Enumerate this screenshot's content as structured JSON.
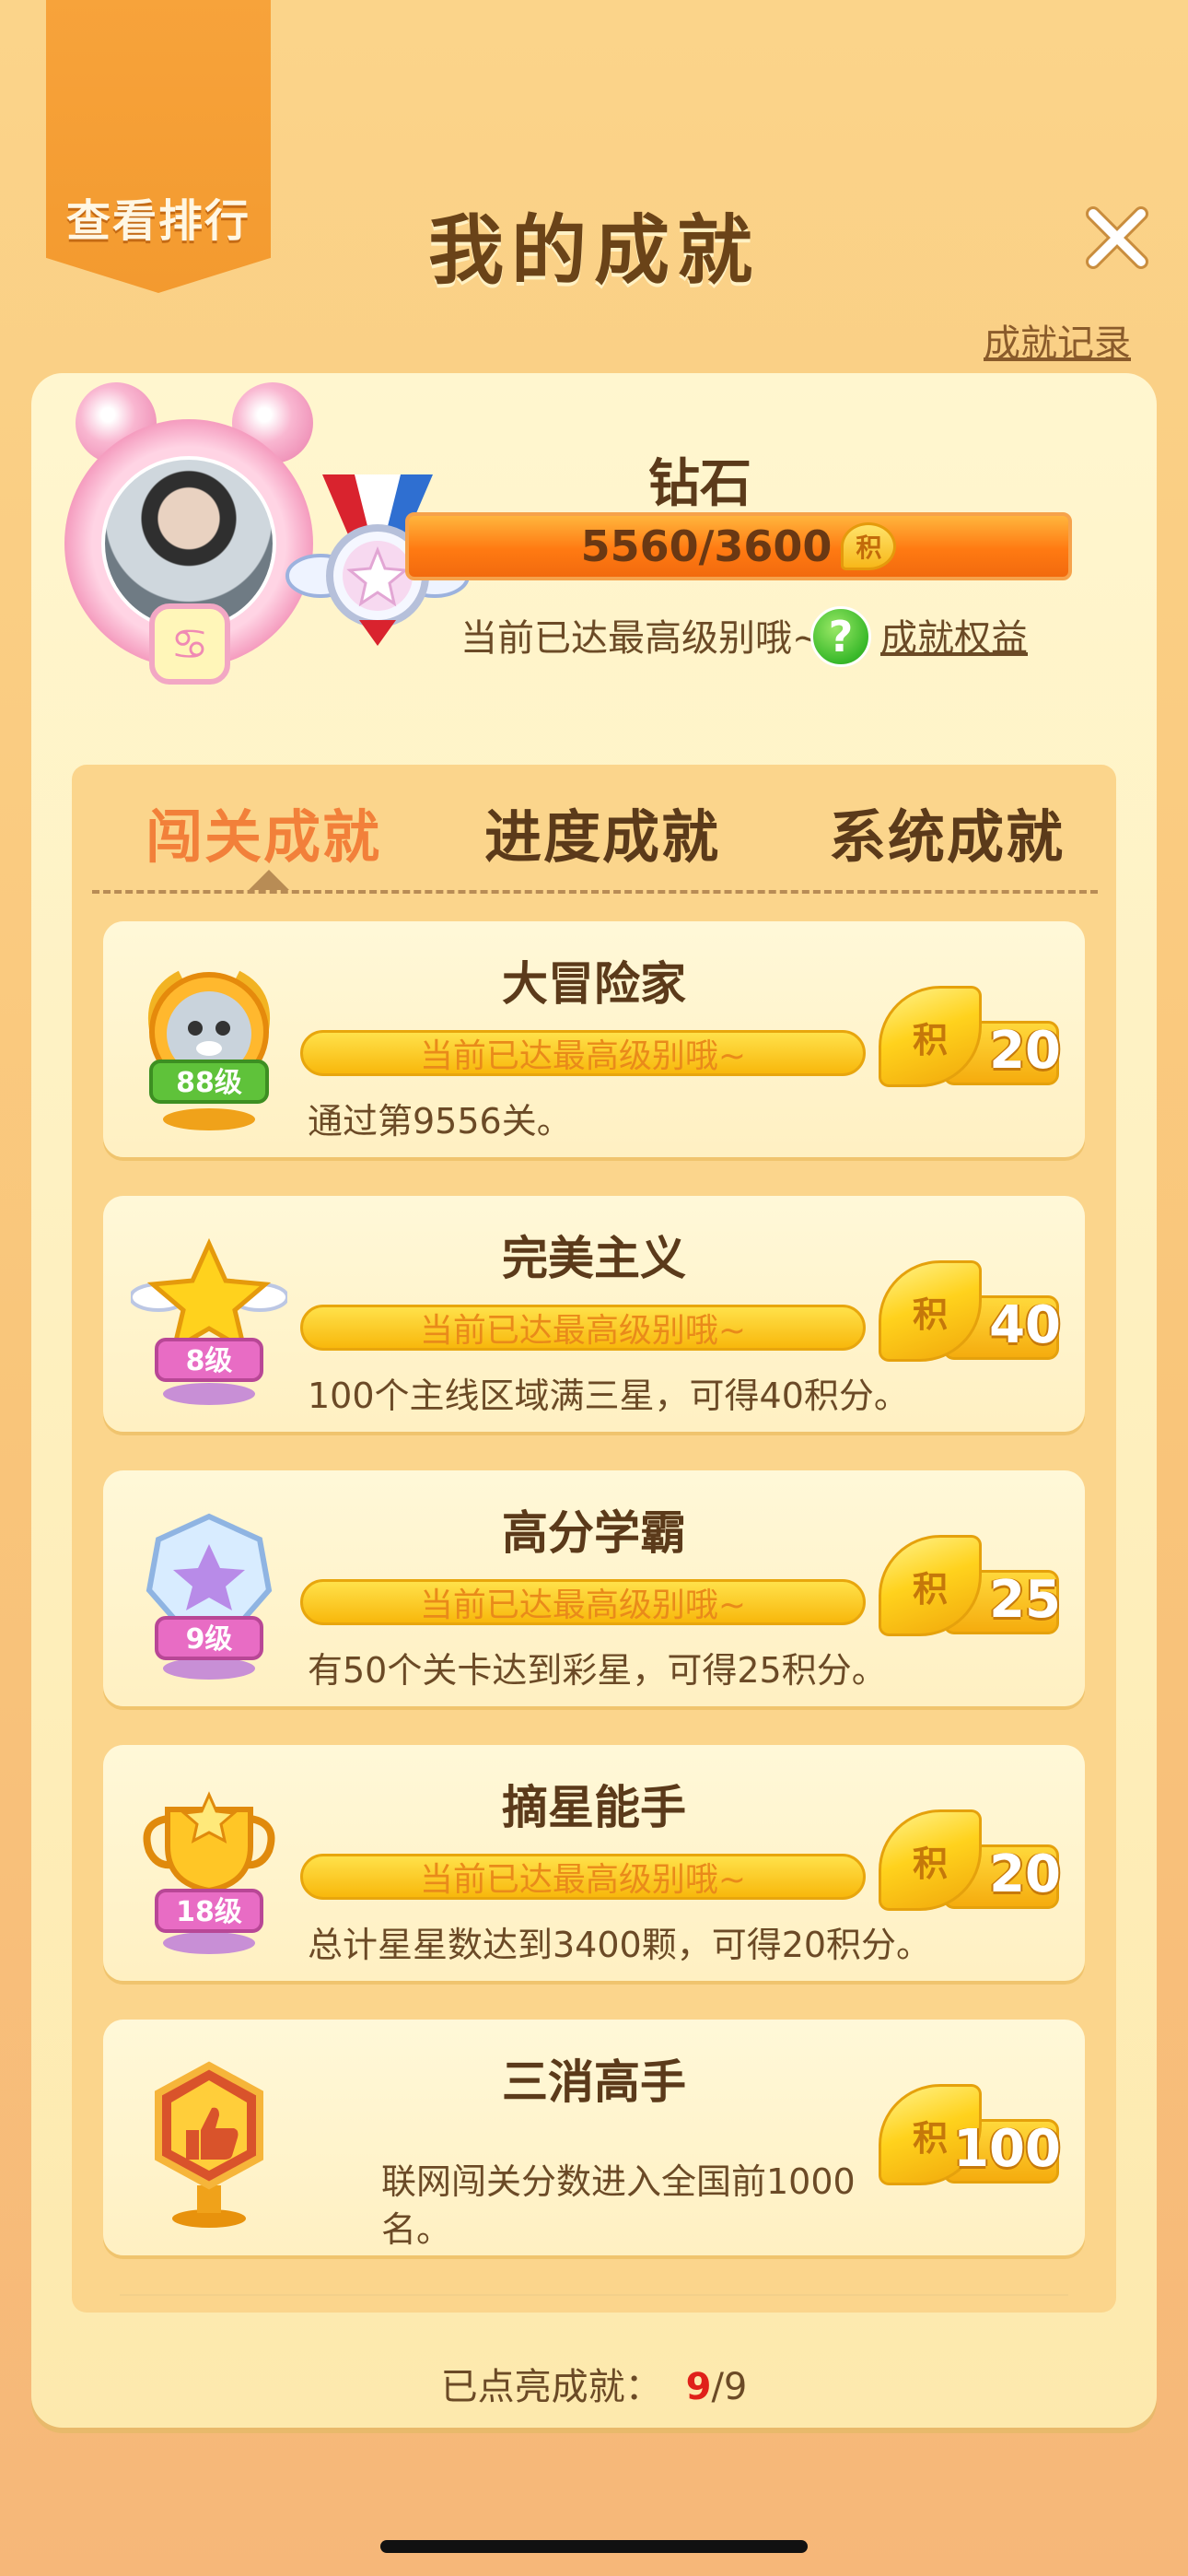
{
  "header": {
    "rank_button_label": "查看排行",
    "title": "我的成就",
    "record_link": "成就记录"
  },
  "profile": {
    "level_name": "钻石",
    "points_current": "5560",
    "points_max": "3600",
    "points_text": "5560/3600",
    "coin_glyph": "积",
    "status_note": "当前已达最高级别哦~",
    "help_glyph": "?",
    "benefit_link": "成就权益",
    "zodiac_glyph": "♋"
  },
  "tabs": [
    {
      "label": "闯关成就",
      "active": true
    },
    {
      "label": "进度成就",
      "active": false
    },
    {
      "label": "系统成就",
      "active": false
    }
  ],
  "achievements": [
    {
      "title": "大冒险家",
      "badge_level": "88级",
      "bar_text": "当前已达最高级别哦~",
      "description": "通过第9556关。",
      "reward_glyph": "积",
      "reward_points": "20"
    },
    {
      "title": "完美主义",
      "badge_level": "8级",
      "bar_text": "当前已达最高级别哦~",
      "description": "100个主线区域满三星，可得40积分。",
      "reward_glyph": "积",
      "reward_points": "40"
    },
    {
      "title": "高分学霸",
      "badge_level": "9级",
      "bar_text": "当前已达最高级别哦~",
      "description": "有50个关卡达到彩星，可得25积分。",
      "reward_glyph": "积",
      "reward_points": "25"
    },
    {
      "title": "摘星能手",
      "badge_level": "18级",
      "bar_text": "当前已达最高级别哦~",
      "description": "总计星星数达到3400颗，可得20积分。",
      "reward_glyph": "积",
      "reward_points": "20"
    },
    {
      "title": "三消高手",
      "description": "联网闯关分数进入全国前1000名。",
      "reward_glyph": "积",
      "reward_points": "100"
    }
  ],
  "footer": {
    "label": "已点亮成就：",
    "lit": "9",
    "total_text": "/9"
  },
  "colors": {
    "accent_orange": "#f2803a",
    "level_bar": "#ff7a12",
    "reward_gold": "#ffd21d",
    "text_brown": "#5b3a1a",
    "count_red": "#e0201a"
  },
  "icons": [
    "close-icon",
    "medal-icon",
    "help-icon",
    "hamster-badge-icon",
    "winged-star-badge-icon",
    "gem-badge-icon",
    "trophy-badge-icon",
    "thumbs-up-badge-icon",
    "reward-coin-icon"
  ]
}
